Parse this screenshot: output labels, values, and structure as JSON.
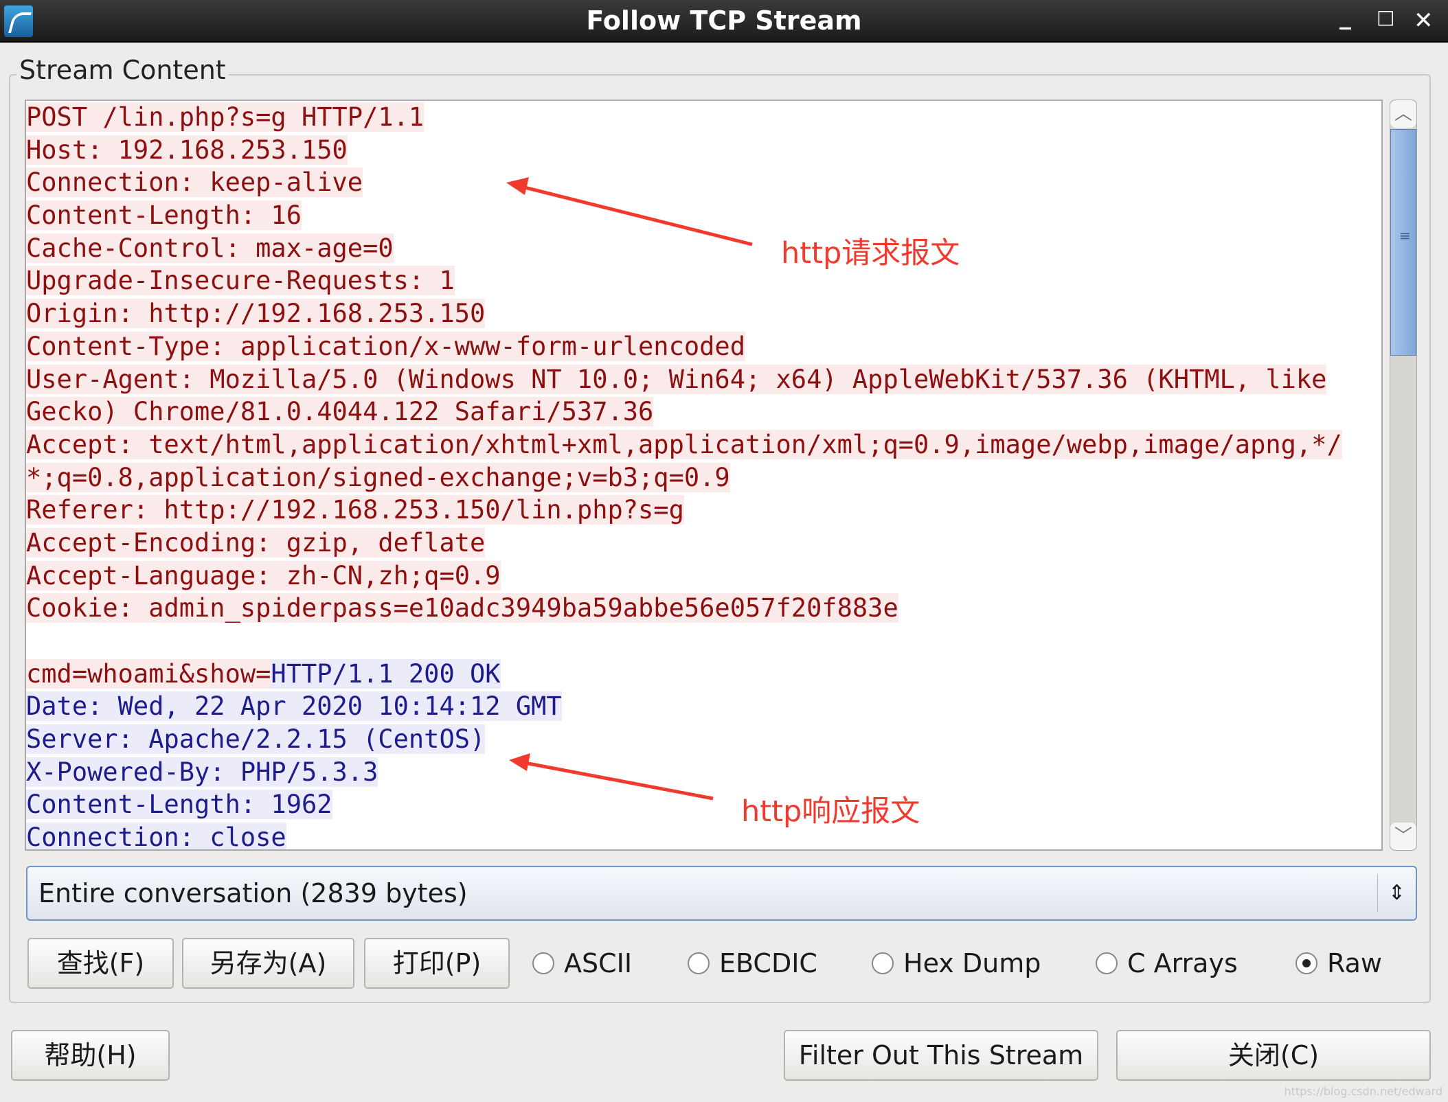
{
  "window": {
    "title": "Follow TCP Stream",
    "controls": [
      "minimize",
      "maximize",
      "close"
    ]
  },
  "group": {
    "label": "Stream Content"
  },
  "stream": {
    "lines": [
      [
        {
          "t": "POST /lin.php?s=g HTTP/1.1",
          "k": "req"
        }
      ],
      [
        {
          "t": "Host: 192.168.253.150",
          "k": "req"
        }
      ],
      [
        {
          "t": "Connection: keep-alive",
          "k": "req"
        }
      ],
      [
        {
          "t": "Content-Length: 16",
          "k": "req"
        }
      ],
      [
        {
          "t": "Cache-Control: max-age=0",
          "k": "req"
        }
      ],
      [
        {
          "t": "Upgrade-Insecure-Requests: 1",
          "k": "req"
        }
      ],
      [
        {
          "t": "Origin: http://192.168.253.150",
          "k": "req"
        }
      ],
      [
        {
          "t": "Content-Type: application/x-www-form-urlencoded",
          "k": "req"
        }
      ],
      [
        {
          "t": "User-Agent: Mozilla/5.0 (Windows NT 10.0; Win64; x64) AppleWebKit/537.36 (KHTML, like",
          "k": "req"
        }
      ],
      [
        {
          "t": "Gecko) Chrome/81.0.4044.122 Safari/537.36",
          "k": "req"
        }
      ],
      [
        {
          "t": "Accept: text/html,application/xhtml+xml,application/xml;q=0.9,image/webp,image/apng,*/",
          "k": "req"
        }
      ],
      [
        {
          "t": "*;q=0.8,application/signed-exchange;v=b3;q=0.9",
          "k": "req"
        }
      ],
      [
        {
          "t": "Referer: http://192.168.253.150/lin.php?s=g",
          "k": "req"
        }
      ],
      [
        {
          "t": "Accept-Encoding: gzip, deflate",
          "k": "req"
        }
      ],
      [
        {
          "t": "Accept-Language: zh-CN,zh;q=0.9",
          "k": "req"
        }
      ],
      [
        {
          "t": "Cookie: admin_spiderpass=e10adc3949ba59abbe56e057f20f883e",
          "k": "req"
        }
      ],
      [],
      [
        {
          "t": "cmd=whoami&show=",
          "k": "req"
        },
        {
          "t": "HTTP/1.1 200 OK",
          "k": "resp"
        }
      ],
      [
        {
          "t": "Date: Wed, 22 Apr 2020 10:14:12 GMT",
          "k": "resp"
        }
      ],
      [
        {
          "t": "Server: Apache/2.2.15 (CentOS)",
          "k": "resp"
        }
      ],
      [
        {
          "t": "X-Powered-By: PHP/5.3.3",
          "k": "resp"
        }
      ],
      [
        {
          "t": "Content-Length: 1962",
          "k": "resp"
        }
      ],
      [
        {
          "t": "Connection: close",
          "k": "resp"
        }
      ]
    ],
    "colors": {
      "request_text": "#8c1010",
      "request_bg": "#fbeaea",
      "response_text": "#1c1c8c",
      "response_bg": "#ebebf9"
    }
  },
  "conversation_select": {
    "value": "Entire conversation (2839 bytes)"
  },
  "buttons": {
    "find": "查找(F)",
    "save_as": "另存为(A)",
    "print": "打印(P)",
    "help": "帮助(H)",
    "filter_out": "Filter Out This Stream",
    "close": "关闭(C)"
  },
  "format": {
    "options": [
      "ASCII",
      "EBCDIC",
      "Hex Dump",
      "C Arrays",
      "Raw"
    ],
    "selected": "Raw"
  },
  "annotations": {
    "request": "http请求报文",
    "response": "http响应报文",
    "color": "#f03a2e"
  },
  "watermark": "https://blog.csdn.net/edward"
}
